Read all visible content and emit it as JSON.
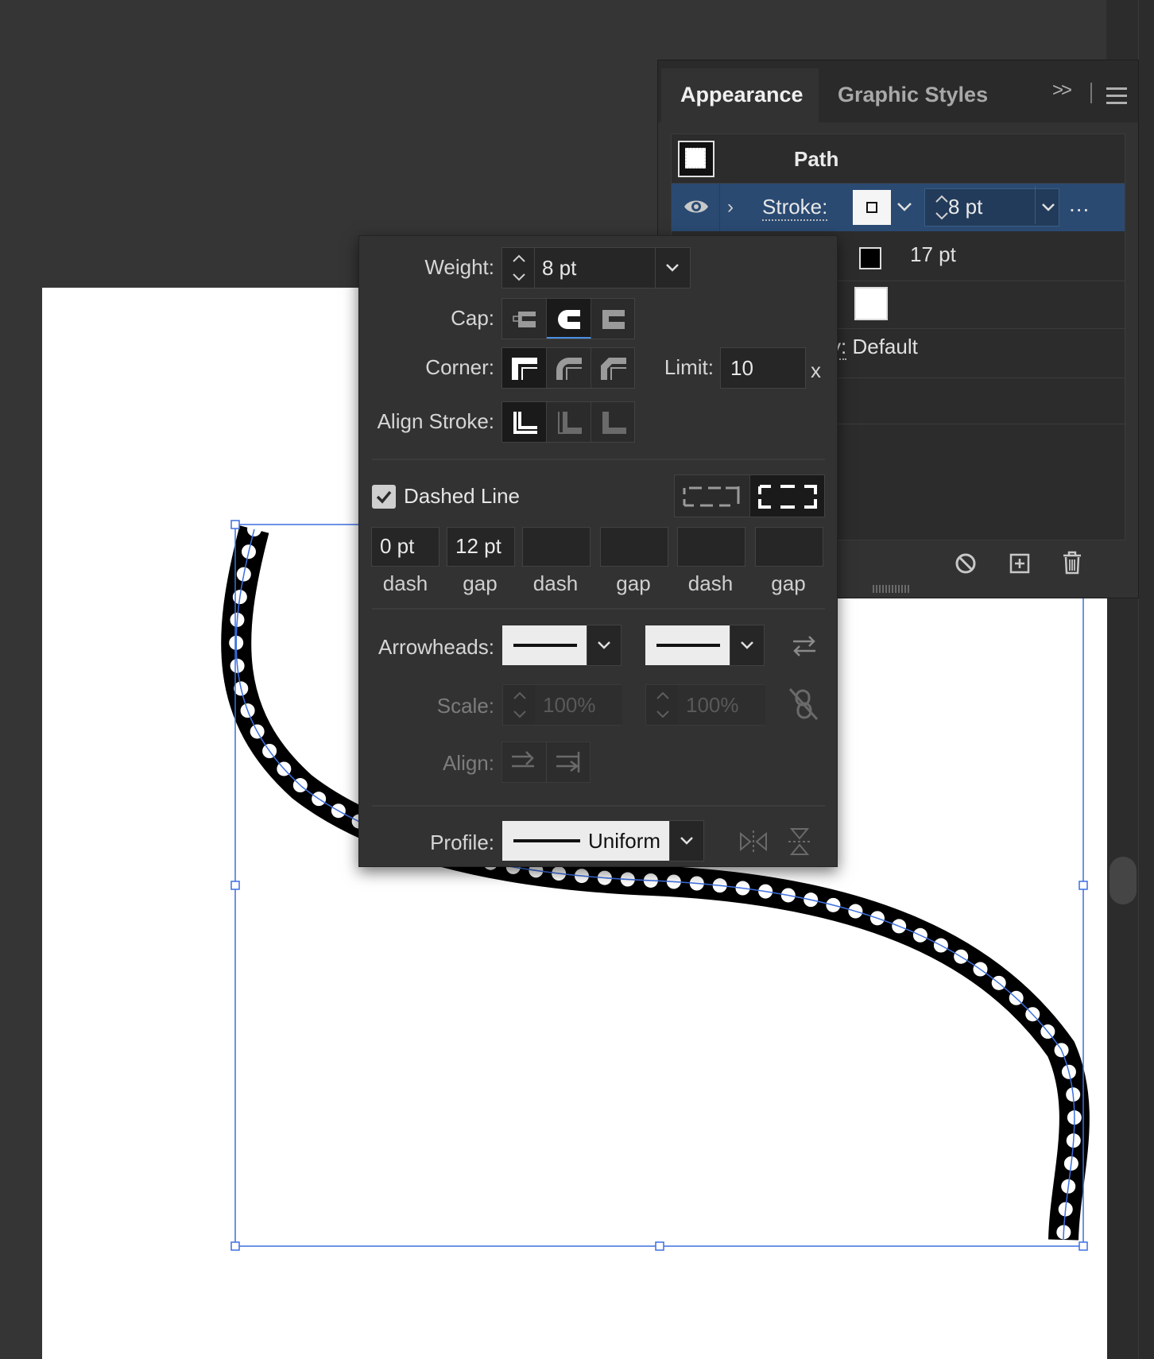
{
  "panel": {
    "tabs": [
      "Appearance",
      "Graphic Styles"
    ],
    "collapse_icon": ">>",
    "path_label": "Path",
    "stroke_label": "Stroke:",
    "stroke_weight": "8 pt",
    "stroke_more": "...",
    "row3_value": "17 pt",
    "row5_label_fragment": "y:",
    "row5_value": "Default"
  },
  "popover": {
    "weight_label": "Weight:",
    "weight_value": "8 pt",
    "cap_label": "Cap:",
    "corner_label": "Corner:",
    "limit_label": "Limit:",
    "limit_value": "10",
    "limit_unit": "x",
    "align_stroke_label": "Align Stroke:",
    "dashed_line_label": "Dashed Line",
    "dashed_line_checked": true,
    "dash_values": [
      "0 pt",
      "12 pt",
      "",
      "",
      "",
      ""
    ],
    "dash_captions": [
      "dash",
      "gap",
      "dash",
      "gap",
      "dash",
      "gap"
    ],
    "arrowheads_label": "Arrowheads:",
    "scale_label": "Scale:",
    "scale_start": "100%",
    "scale_end": "100%",
    "align_label": "Align:",
    "profile_label": "Profile:",
    "profile_value": "Uniform"
  },
  "colors": {
    "selection_blue": "#3d6fe0",
    "stroke_row_bg": "#2a4a72",
    "panel_bg": "#323232",
    "canvas_bg": "#353535"
  }
}
